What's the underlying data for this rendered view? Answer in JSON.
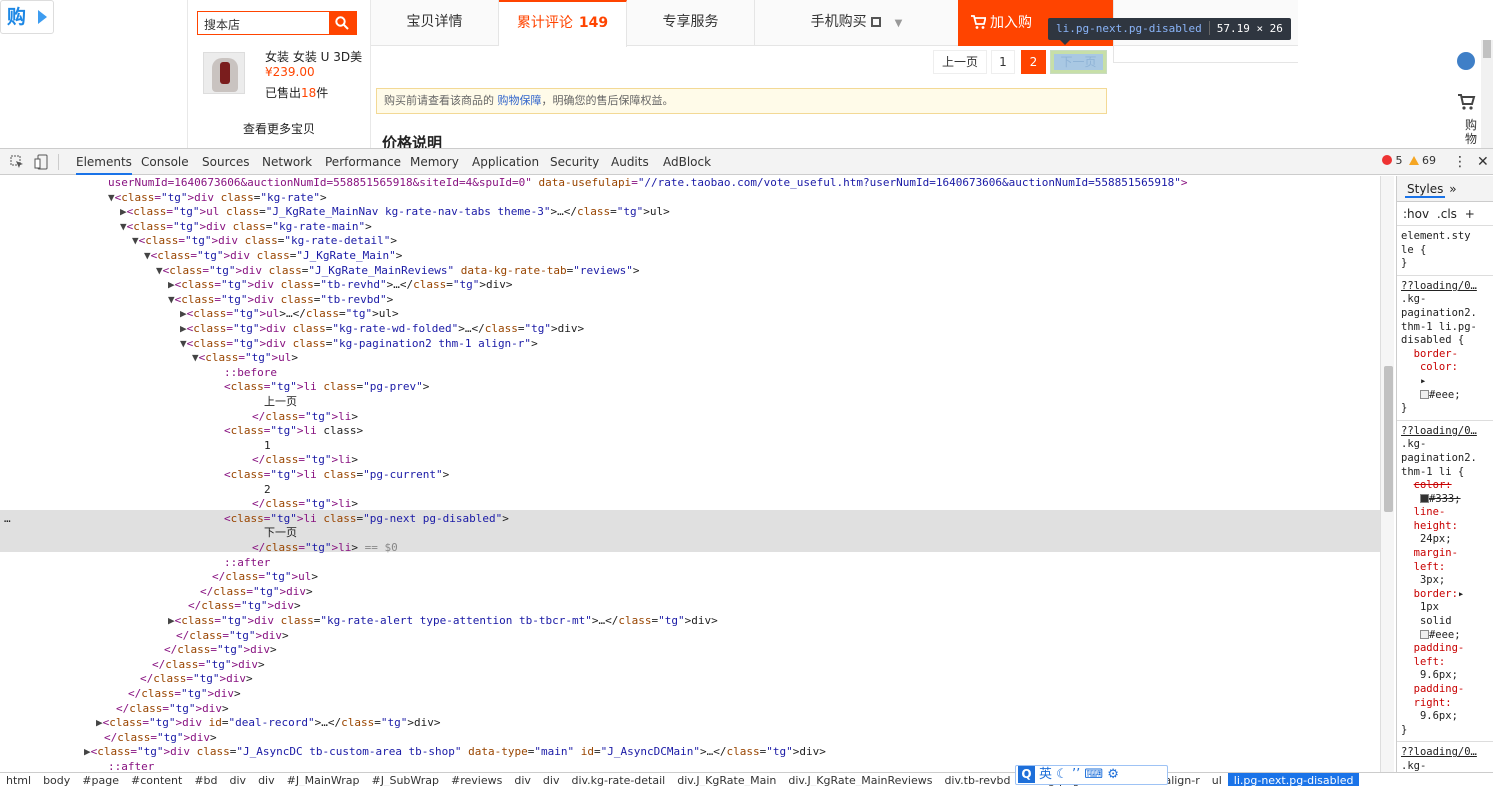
{
  "page": {
    "gou_char": "购",
    "search_placeholder": "搜本店",
    "product_title": "女装 女装 U 3D美",
    "product_price": "¥239.00",
    "sold_prefix": "已售出",
    "sold_count": "18",
    "sold_suffix": "件",
    "see_more": "查看更多宝贝",
    "tabs": [
      "宝贝详情",
      "累计评论",
      "专享服务",
      "手机购买"
    ],
    "review_count": "149",
    "add_cart": "加入购",
    "tooltip_selector": "li.pg-next.pg-disabled",
    "tooltip_size": "57.19 × 26",
    "pager": {
      "prev": "上一页",
      "p1": "1",
      "current": "2",
      "next": "下一页"
    },
    "notice_pre": "购买前请查看该商品的 ",
    "notice_link": "购物保障",
    "notice_post": "，明确您的售后保障权益。",
    "price_heading": "价格说明",
    "cart_label": "购物",
    "colors": {
      "accent": "#ff4400",
      "devtools_blue": "#1a73e8"
    }
  },
  "devtools": {
    "tabs": [
      "Elements",
      "Console",
      "Sources",
      "Network",
      "Performance",
      "Memory",
      "Application",
      "Security",
      "Audits",
      "AdBlock"
    ],
    "error_count": "5",
    "warning_count": "69",
    "styles_tab": "Styles",
    "styles_more": "»",
    "filter_hov": ":hov",
    "filter_cls": ".cls",
    "filter_add": "+",
    "breadcrumbs": [
      "html",
      "body",
      "#page",
      "#content",
      "#bd",
      "div",
      "div",
      "#J_MainWrap",
      "#J_SubWrap",
      "#reviews",
      "div",
      "div",
      "div.kg-rate-detail",
      "div.J_KgRate_Main",
      "div.J_KgRate_MainReviews",
      "div.tb-revbd",
      "div.kg-pagination2.thm-1.align-r",
      "ul",
      "li.pg-next.pg-disabled"
    ],
    "code_lines": [
      "userNumId=1640673606&auctionNumId=558851565918&siteId=4&spuId=0\" data-usefulapi=\"//rate.taobao.com/vote_useful.htm?userNumId=1640673606&auctionNumId=558851565918\">",
      "<div class=\"kg-rate\">",
      "<ul class=\"J_KgRate_MainNav kg-rate-nav-tabs theme-3\">…</ul>",
      "<div class=\"kg-rate-main\">",
      "<div class=\"kg-rate-detail\">",
      "<div class=\"J_KgRate_Main\">",
      "<div class=\"J_KgRate_MainReviews\" data-kg-rate-tab=\"reviews\">",
      "<div class=\"tb-revhd\">…</div>",
      "<div class=\"tb-revbd\">",
      "<ul>…</ul>",
      "<div class=\"kg-rate-wd-folded\">…</div>",
      "<div class=\"kg-pagination2 thm-1 align-r\">",
      "<ul>",
      "::before",
      "<li class=\"pg-prev\">",
      "上一页",
      "</li>",
      "<li class>",
      "1",
      "</li>",
      "<li class=\"pg-current\">",
      "2",
      "</li>",
      "<li class=\"pg-next pg-disabled\">",
      "下一页",
      "</li> == $0",
      "::after",
      "</ul>",
      "</div>",
      "</div>",
      "<div class=\"kg-rate-alert type-attention tb-tbcr-mt\">…</div>",
      "</div>",
      "</div>",
      "</div>",
      "</div>",
      "</div>",
      "</div>",
      "<div id=\"deal-record\">…</div>",
      "</div>",
      "<div class=\"J_AsyncDC tb-custom-area tb-shop\" data-type=\"main\" id=\"J_AsyncDCMain\">…</div>",
      "::after"
    ],
    "styles": {
      "element_style": "element.sty\nle {\n}",
      "rule1_src": "??loading/0…",
      "rule1_sel": ".kg-\npagination2.\nthm-1 li.pg-\ndisabled {",
      "rule1_prop": "border-\n   color:",
      "rule1_val": "#eee;",
      "rule2_src": "??loading/0…",
      "rule2_sel": ".kg-\npagination2.\nthm-1 li {",
      "rule2_color_prop": "color:",
      "rule2_color_val": "#333;",
      "rule2_lh_prop": "line-\n  height:",
      "rule2_lh_val": "24px;",
      "rule2_ml_prop": "margin-\n  left:",
      "rule2_ml_val": "3px;",
      "rule2_b_prop": "border:",
      "rule2_b_val": "1px\n   solid",
      "rule2_b_col": "#eee;",
      "rule2_pl_prop": "padding-\n  left:",
      "rule2_pl_val": "9.6px;",
      "rule2_pr_prop": "padding-\n  right:",
      "rule2_pr_val": "9.6px;",
      "rule3_src": "??loading/0…",
      "rule3_sel": ".kg-"
    },
    "ime": {
      "logo": "Q",
      "lang": "英"
    }
  }
}
